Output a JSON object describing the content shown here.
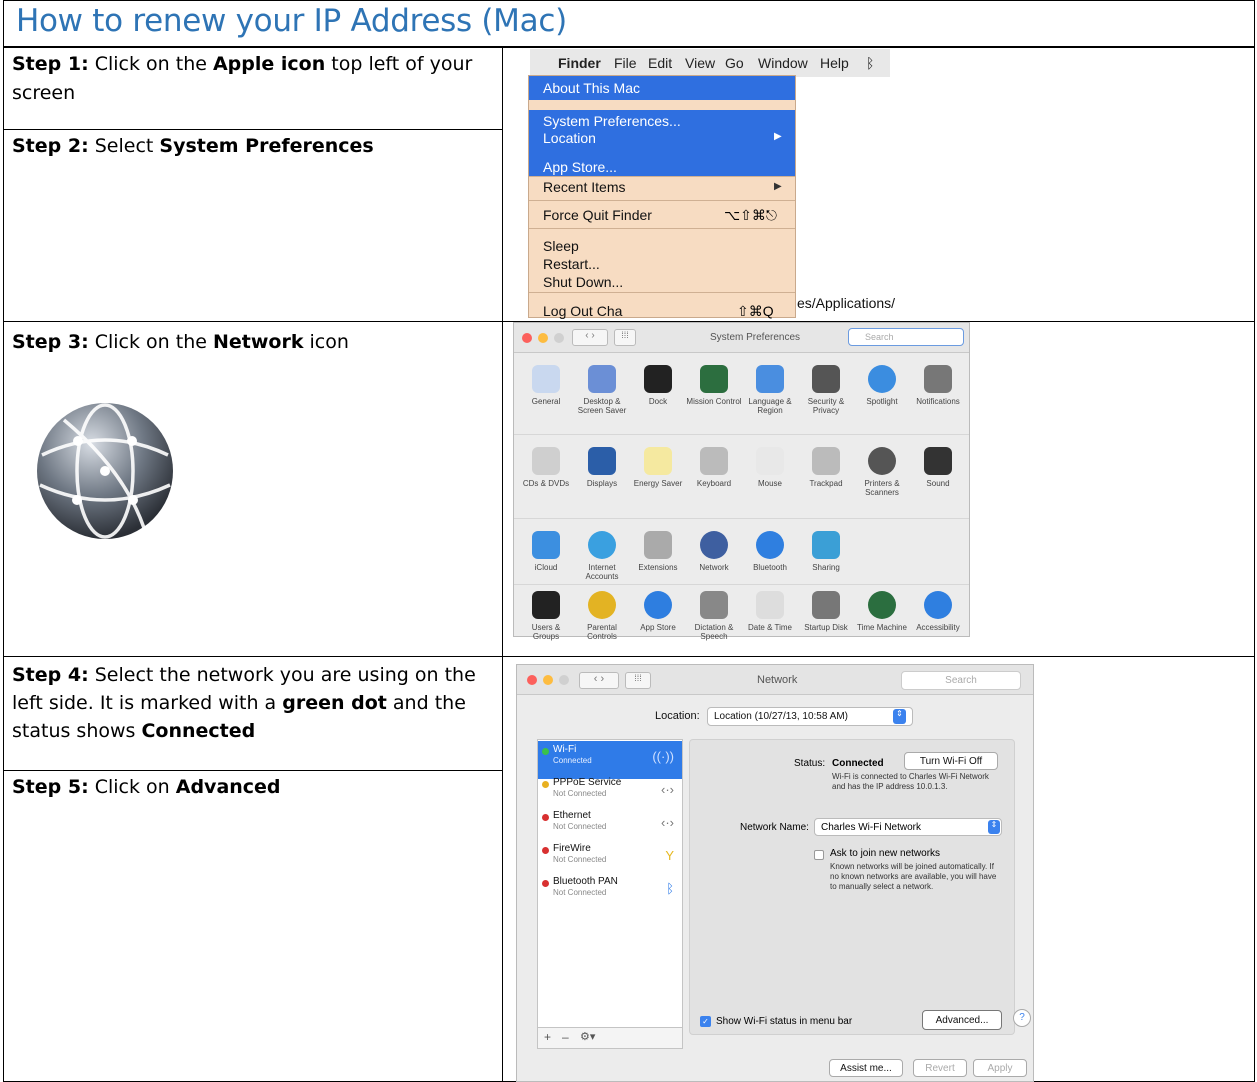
{
  "title": "How to renew your IP Address (Mac)",
  "steps": {
    "s1_label": "Step 1:",
    "s1_a": " Click on the ",
    "s1_b": "Apple icon",
    "s1_c": " top left of your screen",
    "s2_label": "Step 2:",
    "s2_a": " Select ",
    "s2_b": "System Preferences",
    "s3_label": "Step 3:",
    "s3_a": " Click on the ",
    "s3_b": "Network",
    "s3_c": " icon",
    "s4_label": "Step 4:",
    "s4_a": " Select the network you are using on the left side. It is marked with a ",
    "s4_b": "green dot",
    "s4_c": " and the status shows ",
    "s4_d": "Connected",
    "s5_label": "Step 5:",
    "s5_a": " Click on ",
    "s5_b": "Advanced"
  },
  "finder_menu": {
    "menubar": [
      "Finder",
      "File",
      "Edit",
      "View",
      "Go",
      "Window",
      "Help"
    ],
    "items": [
      "About This Mac",
      "System Preferences...",
      "Location",
      "App Store...",
      "Recent Items",
      "Force Quit Finder",
      "Sleep",
      "Restart...",
      "Shut Down...",
      "Log Out Cha"
    ],
    "shortcut_force_quit": "⌥⇧⌘⎋",
    "shortcut_logout": "⇧⌘Q",
    "path_text": "es/Applications/"
  },
  "sysprefs": {
    "title": "System Preferences",
    "search_placeholder": "Search",
    "rows": [
      [
        "General",
        "Desktop & Screen Saver",
        "Dock",
        "Mission Control",
        "Language & Region",
        "Security & Privacy",
        "Spotlight",
        "Notifications"
      ],
      [
        "CDs & DVDs",
        "Displays",
        "Energy Saver",
        "Keyboard",
        "Mouse",
        "Trackpad",
        "Printers & Scanners",
        "Sound"
      ],
      [
        "iCloud",
        "Internet Accounts",
        "Extensions",
        "Network",
        "Bluetooth",
        "Sharing"
      ],
      [
        "Users & Groups",
        "Parental Controls",
        "App Store",
        "Dictation & Speech",
        "Date & Time",
        "Startup Disk",
        "Time Machine",
        "Accessibility"
      ]
    ],
    "row_colors": [
      [
        "#c9d8ef",
        "#6b8fd6",
        "#222",
        "#2c6e3f",
        "#4a8ee0",
        "#555",
        "#3b8de0",
        "#777"
      ],
      [
        "#cfcfcf",
        "#2b5ea8",
        "#f5e9a0",
        "#bbb",
        "#e8e8e8",
        "#bbb",
        "#555",
        "#333"
      ],
      [
        "#3c8fe0",
        "#3aa0e0",
        "#aaa",
        "#3e5fa0",
        "#2f7fe0",
        "#3b9fd6"
      ],
      [
        "#222",
        "#e3b323",
        "#2e7ee0",
        "#888",
        "#ddd",
        "#777",
        "#2b6e3f",
        "#2f7fe0"
      ]
    ]
  },
  "network": {
    "title": "Network",
    "search_placeholder": "Search",
    "location_label": "Location:",
    "location_value": "Location (10/27/13, 10:58 AM)",
    "services": [
      {
        "name": "Wi-Fi",
        "status": "Connected",
        "dot": "#3ac24a",
        "selected": true
      },
      {
        "name": "PPPoE Service",
        "status": "Not Connected",
        "dot": "#e8b020"
      },
      {
        "name": "Ethernet",
        "status": "Not Connected",
        "dot": "#d83030"
      },
      {
        "name": "FireWire",
        "status": "Not Connected",
        "dot": "#d83030"
      },
      {
        "name": "Bluetooth PAN",
        "status": "Not Connected",
        "dot": "#d83030"
      }
    ],
    "status_label": "Status:",
    "status_value": "Connected",
    "turn_off_button": "Turn Wi-Fi Off",
    "status_desc": "Wi-Fi is connected to Charles Wi-Fi Network and has the IP address 10.0.1.3.",
    "network_name_label": "Network Name:",
    "network_name_value": "Charles Wi-Fi Network",
    "ask_join_label": "Ask to join new networks",
    "ask_join_desc": "Known networks will be joined automatically. If no known networks are available, you will have to manually select a network.",
    "show_wifi_label": "Show Wi-Fi status in menu bar",
    "advanced_button": "Advanced...",
    "help_button": "?",
    "assist_button": "Assist me...",
    "revert_button": "Revert",
    "apply_button": "Apply",
    "plus": "+",
    "minus": "–"
  }
}
